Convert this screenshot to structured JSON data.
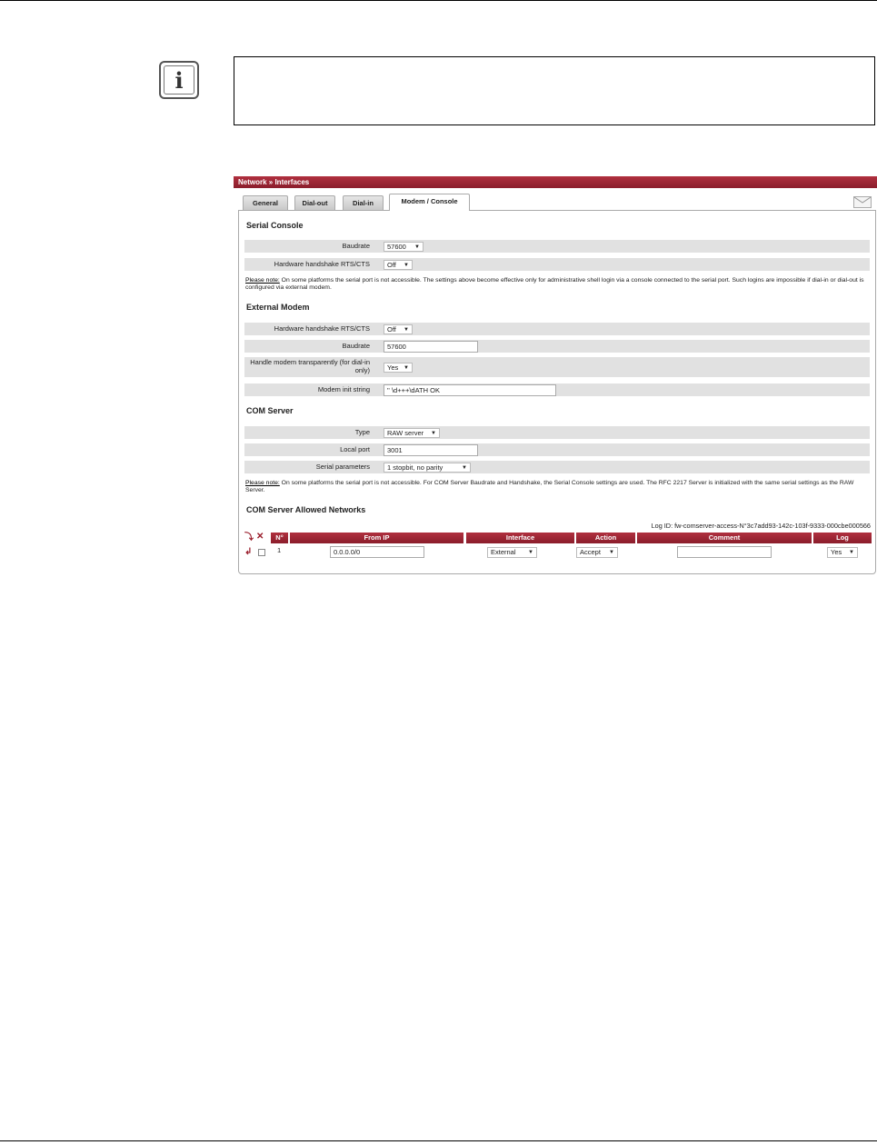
{
  "colors": {
    "accent": "#9a1d2b",
    "row_bg": "#e1e1e1"
  },
  "info_icon": "info-icon",
  "window": {
    "breadcrumb": "Network » Interfaces"
  },
  "tabs": [
    {
      "label": "General"
    },
    {
      "label": "Dial-out"
    },
    {
      "label": "Dial-in"
    },
    {
      "label": "Modem / Console"
    }
  ],
  "serial_console": {
    "title": "Serial Console",
    "baudrate": {
      "label": "Baudrate",
      "value": "57600"
    },
    "handshake": {
      "label": "Hardware handshake RTS/CTS",
      "value": "Off"
    },
    "note_prefix": "Please note:",
    "note_text": " On some platforms the serial port is not accessible. The settings above become effective only for administrative shell login via a console connected to the serial port. Such logins are impossible if dial-in or dial-out is configured via external modem."
  },
  "external_modem": {
    "title": "External Modem",
    "handshake": {
      "label": "Hardware handshake RTS/CTS",
      "value": "Off"
    },
    "baudrate": {
      "label": "Baudrate",
      "value": "57600"
    },
    "transparent": {
      "label": "Handle modem transparently (for dial-in only)",
      "value": "Yes"
    },
    "init_string": {
      "label": "Modem init string",
      "value": "'' \\d+++\\dATH OK"
    }
  },
  "com_server": {
    "title": "COM Server",
    "type": {
      "label": "Type",
      "value": "RAW server"
    },
    "local_port": {
      "label": "Local port",
      "value": "3001"
    },
    "serial_params": {
      "label": "Serial parameters",
      "value": "1 stopbit, no parity"
    },
    "note_prefix": "Please note:",
    "note_text": " On some platforms the serial port is not accessible. For COM Server Baudrate and Handshake, the Serial Console settings are used. The RFC 2217 Server is initialized with the same serial settings as the RAW Server."
  },
  "allowed_networks": {
    "title": "COM Server Allowed Networks",
    "log_id": "Log ID: fw-comserver-access-N°3c7add93-142c-103f-9333-000cbe000566",
    "columns": [
      "N°",
      "From IP",
      "Interface",
      "Action",
      "Comment",
      "Log"
    ],
    "rows": [
      {
        "number": "1",
        "from_ip": "0.0.0.0/0",
        "interface": "External",
        "action": "Accept",
        "comment": "",
        "log": "Yes"
      }
    ]
  }
}
